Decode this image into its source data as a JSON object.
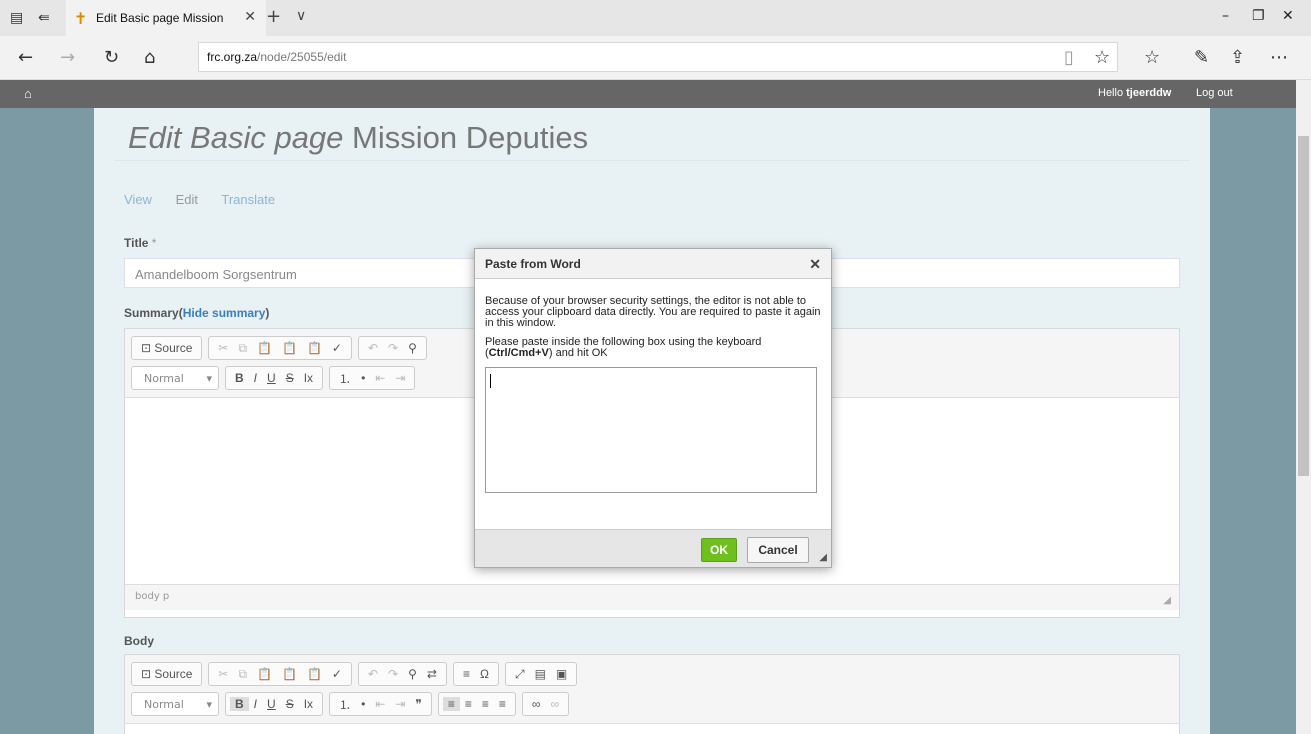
{
  "browser": {
    "tab_title": "Edit Basic page Mission",
    "url_domain": "frc.org.za",
    "url_path": "/node/25055/edit"
  },
  "adminbar": {
    "hello_prefix": "Hello ",
    "username": "tjeerddw",
    "logout": "Log out"
  },
  "page": {
    "title_italic": "Edit Basic page",
    "title_rest": " Mission Deputies",
    "tabs": [
      "View",
      "Edit",
      "Translate"
    ]
  },
  "form": {
    "title_label": "Title",
    "title_required": " *",
    "title_value": "Amandelboom Sorgsentrum",
    "summary_label": "Summary",
    "summary_open_paren": "(",
    "summary_link": "Hide summary",
    "summary_close_paren": ")",
    "body_label": "Body"
  },
  "editor": {
    "source_label": "Source",
    "format_value": "Normal",
    "statusbar_path": "body  p"
  },
  "dialog": {
    "title": "Paste from Word",
    "message1": "Because of your browser security settings, the editor is not able to access your clipboard data directly. You are required to paste it again in this window.",
    "message2_prefix": "Please paste inside the following box using the keyboard (",
    "message2_keys": "Ctrl/Cmd+V",
    "message2_suffix": ") and hit OK",
    "ok_label": "OK",
    "cancel_label": "Cancel"
  },
  "colors": {
    "accent_ok": "#6fbf1e",
    "link": "#3b7dbf",
    "admin_bar": "#666666"
  }
}
